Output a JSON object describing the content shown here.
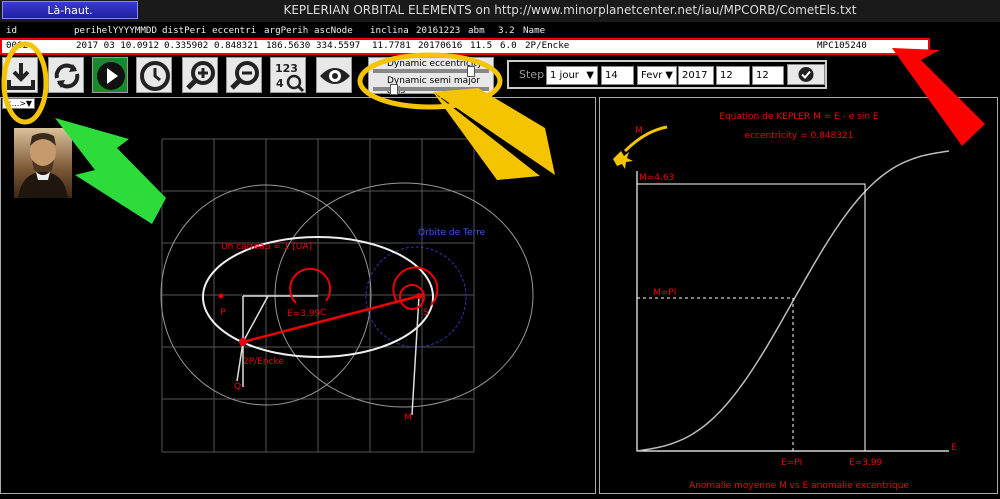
{
  "topbar": {
    "back_label": "Là-haut.",
    "title": "KEPLERIAN ORBITAL ELEMENTS on http://www.minorplanetcenter.net/iau/MPCORB/CometEls.txt"
  },
  "table": {
    "headers": [
      "id",
      "perihelYYYYMMDD",
      "distPeri",
      "eccentri",
      "argPerih",
      "ascNode",
      "inclina",
      "20161223",
      "abm",
      "3.2",
      "Name"
    ],
    "row": [
      "0002",
      "2017 03 10.0912",
      "0.335902",
      "0.848321",
      "186.5630",
      "334.5597",
      "11.7781",
      "20170616",
      "11.5",
      "6.0",
      "2P/Encke",
      "MPC105240"
    ]
  },
  "toolbar": {
    "buttons": [
      {
        "name": "download-icon"
      },
      {
        "name": "refresh-icon"
      },
      {
        "name": "play-icon"
      },
      {
        "name": "clock-icon"
      },
      {
        "name": "zoom-in-icon"
      },
      {
        "name": "zoom-out-icon"
      },
      {
        "name": "numbers-zoom-icon",
        "label": "123 4"
      },
      {
        "name": "eye-icon"
      }
    ],
    "sliders": {
      "eccentricity_label": "Dynamic eccentricity",
      "semi_major_label": "Dynamic semi major axis",
      "eccentricity_value": 0.85,
      "semi_major_value": 0.15
    }
  },
  "step": {
    "label": "Step",
    "unit": "1 jour",
    "day": "14",
    "month": "Fevr",
    "year": "2017",
    "hour": "12",
    "minute": "12"
  },
  "view_select": "<...>",
  "left_plot": {
    "scale_label": "Un carreau = 1 [UA]",
    "earth_orbit_label": "Orbite de Terre",
    "labels": {
      "E": "E=3.99",
      "C": "C",
      "P": "P",
      "Q": "Q",
      "M": "M",
      "comet": "2P/Encke",
      "sun": "S"
    }
  },
  "right_plot": {
    "title": "Equation de KEPLER  M = E - e sin E",
    "ecc_label": "eccentricity = 0.848321",
    "comet_icon_label": "M",
    "m_value_label": "M=4.63",
    "m_pi_label": "M=PI",
    "e_pi_label": "E=PI",
    "e_value_label": "E=3.99",
    "x_axis_letter": "E",
    "footer": "Anomalie moyenne M vs E anomalie excentrique",
    "colors": {
      "curve": "#bdbdbd",
      "labels": "#e00000",
      "axes": "#ffffff"
    }
  }
}
